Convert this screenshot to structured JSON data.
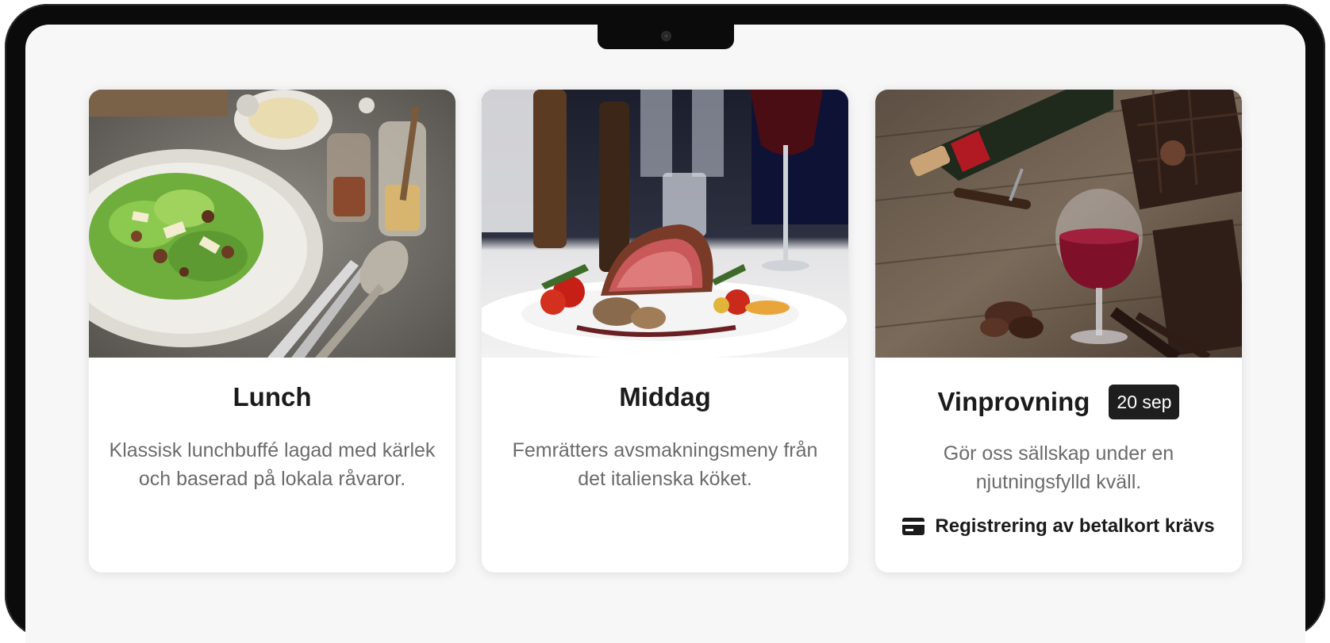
{
  "cards": [
    {
      "title": "Lunch",
      "image": "salad-plate-image",
      "description": "Klassisk lunchbuffé lagad med kärlek och baserad på lokala råvaror."
    },
    {
      "title": "Middag",
      "image": "steak-dinner-image",
      "description": "Femrätters avsmakningsmeny från det italienska köket."
    },
    {
      "title": "Vinprovning",
      "badge": "20 sep",
      "image": "wine-chocolate-image",
      "description": "Gör oss sällskap under en njutningsfylld kväll.",
      "notice": "Registrering av betalkort krävs",
      "notice_icon": "credit-card-icon"
    }
  ]
}
